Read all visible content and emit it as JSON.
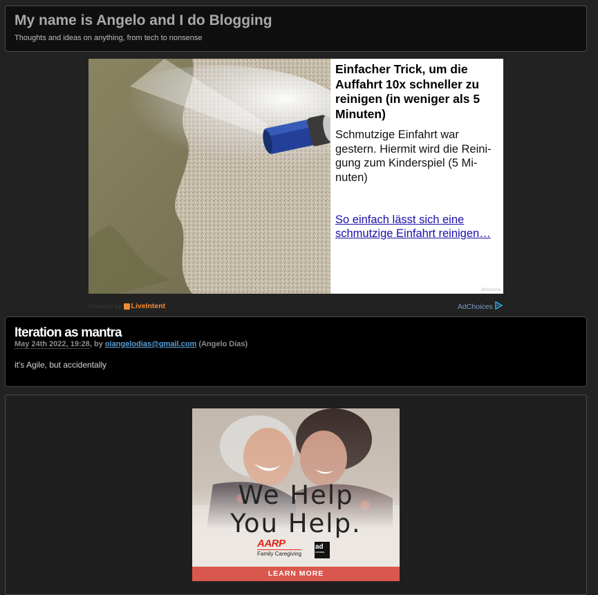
{
  "header": {
    "title": "My name is Angelo and I do Blogging",
    "tagline": "Thoughts and ideas on anything, from tech to nonsense"
  },
  "ad_top": {
    "headline": "Einfacher Trick, um die Auffahrt 10x schneller zu reinigen (in weniger als 5 Minuten)",
    "description": "Schmutzige Einfahrt war gestern. Hiermit wird die Reini-gung zum Kinderspiel (5 Mi-nuten)",
    "link": "So einfach lässt sich eine schmutzige Einfahrt reinigen…",
    "brand": "Jetfaxzone",
    "image_icon": "water-hose-spray-image"
  },
  "ad_footer": {
    "powered_by": "Powered by",
    "provider": "LiveIntent",
    "adchoices": "AdChoices"
  },
  "post": {
    "title": "Iteration as mantra",
    "date": "May 24th 2022, 19:28",
    "by": ", by",
    "author_email": "oiangelodias@gmail.com",
    "author_name": "(Angelo Dias)",
    "body": "it's Agile, but accidentally"
  },
  "ad_bottom": {
    "tagline_line1": "We Help",
    "tagline_line2": "You Help.",
    "aarp_name": "AARP",
    "aarp_sub": "Family Caregiving",
    "council_line1": "ad",
    "council_line2": "COUNCIL",
    "cta": "LEARN MORE",
    "cta_color": "#d9584e"
  },
  "colors": {
    "background": "#222222",
    "link": "#1a0dab",
    "liveintent": "#f18b31"
  }
}
